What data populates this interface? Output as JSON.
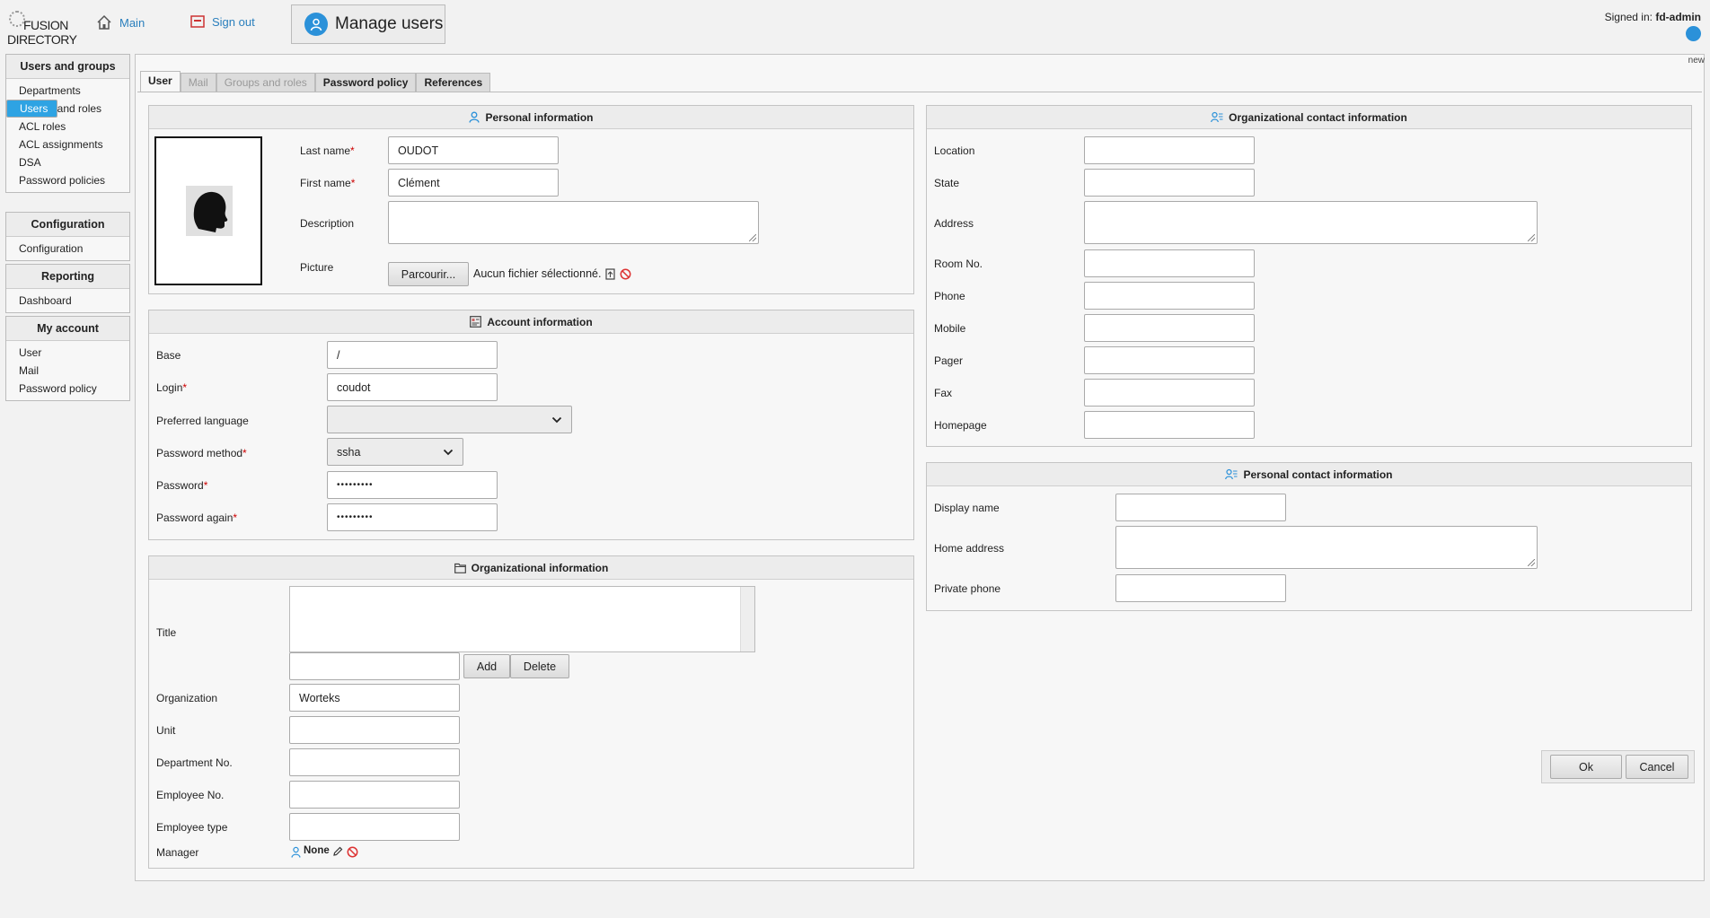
{
  "header": {
    "logo_line1": "FUSION",
    "logo_line2": "DIRECTORY",
    "main_link": "Main",
    "signout_link": "Sign out",
    "page_title": "Manage users",
    "signed_in_label": "Signed in:",
    "signed_in_user": "fd-admin"
  },
  "sidebar": {
    "sections": [
      {
        "title": "Users and groups",
        "items": [
          "Departments",
          "Users",
          "Groups and roles",
          "ACL roles",
          "ACL assignments",
          "DSA",
          "Password policies"
        ],
        "selected": "Users"
      },
      {
        "title": "Configuration",
        "items": [
          "Configuration"
        ]
      },
      {
        "title": "Reporting",
        "items": [
          "Dashboard"
        ]
      },
      {
        "title": "My account",
        "items": [
          "User",
          "Mail",
          "Password policy"
        ]
      }
    ]
  },
  "main": {
    "new_tag": "new",
    "tabs": [
      {
        "label": "User",
        "state": "active"
      },
      {
        "label": "Mail",
        "state": "disabled"
      },
      {
        "label": "Groups and roles",
        "state": "disabled"
      },
      {
        "label": "Password policy",
        "state": "normal"
      },
      {
        "label": "References",
        "state": "normal"
      }
    ]
  },
  "personal": {
    "title": "Personal information",
    "last_name_label": "Last name",
    "last_name": "OUDOT",
    "first_name_label": "First name",
    "first_name": "Clément",
    "description_label": "Description",
    "picture_label": "Picture",
    "browse_button": "Parcourir...",
    "no_file": "Aucun fichier sélectionné."
  },
  "account": {
    "title": "Account information",
    "base_label": "Base",
    "base": "/",
    "login_label": "Login",
    "login": "coudot",
    "language_label": "Preferred language",
    "language": "",
    "pw_method_label": "Password method",
    "pw_method": "ssha",
    "password_label": "Password",
    "password": "•••••••••",
    "password_again_label": "Password again",
    "password_again": "•••••••••"
  },
  "org": {
    "title": "Organizational information",
    "title_label": "Title",
    "add_button": "Add",
    "delete_button": "Delete",
    "organization_label": "Organization",
    "organization": "Worteks",
    "unit_label": "Unit",
    "department_label": "Department No.",
    "employee_no_label": "Employee No.",
    "employee_type_label": "Employee type",
    "manager_label": "Manager",
    "manager": "None"
  },
  "org_contact": {
    "title": "Organizational contact information",
    "location_label": "Location",
    "state_label": "State",
    "address_label": "Address",
    "room_label": "Room No.",
    "phone_label": "Phone",
    "mobile_label": "Mobile",
    "pager_label": "Pager",
    "fax_label": "Fax",
    "homepage_label": "Homepage"
  },
  "personal_contact": {
    "title": "Personal contact information",
    "display_name_label": "Display name",
    "home_address_label": "Home address",
    "private_phone_label": "Private phone"
  },
  "footer": {
    "ok_button": "Ok",
    "cancel_button": "Cancel"
  }
}
